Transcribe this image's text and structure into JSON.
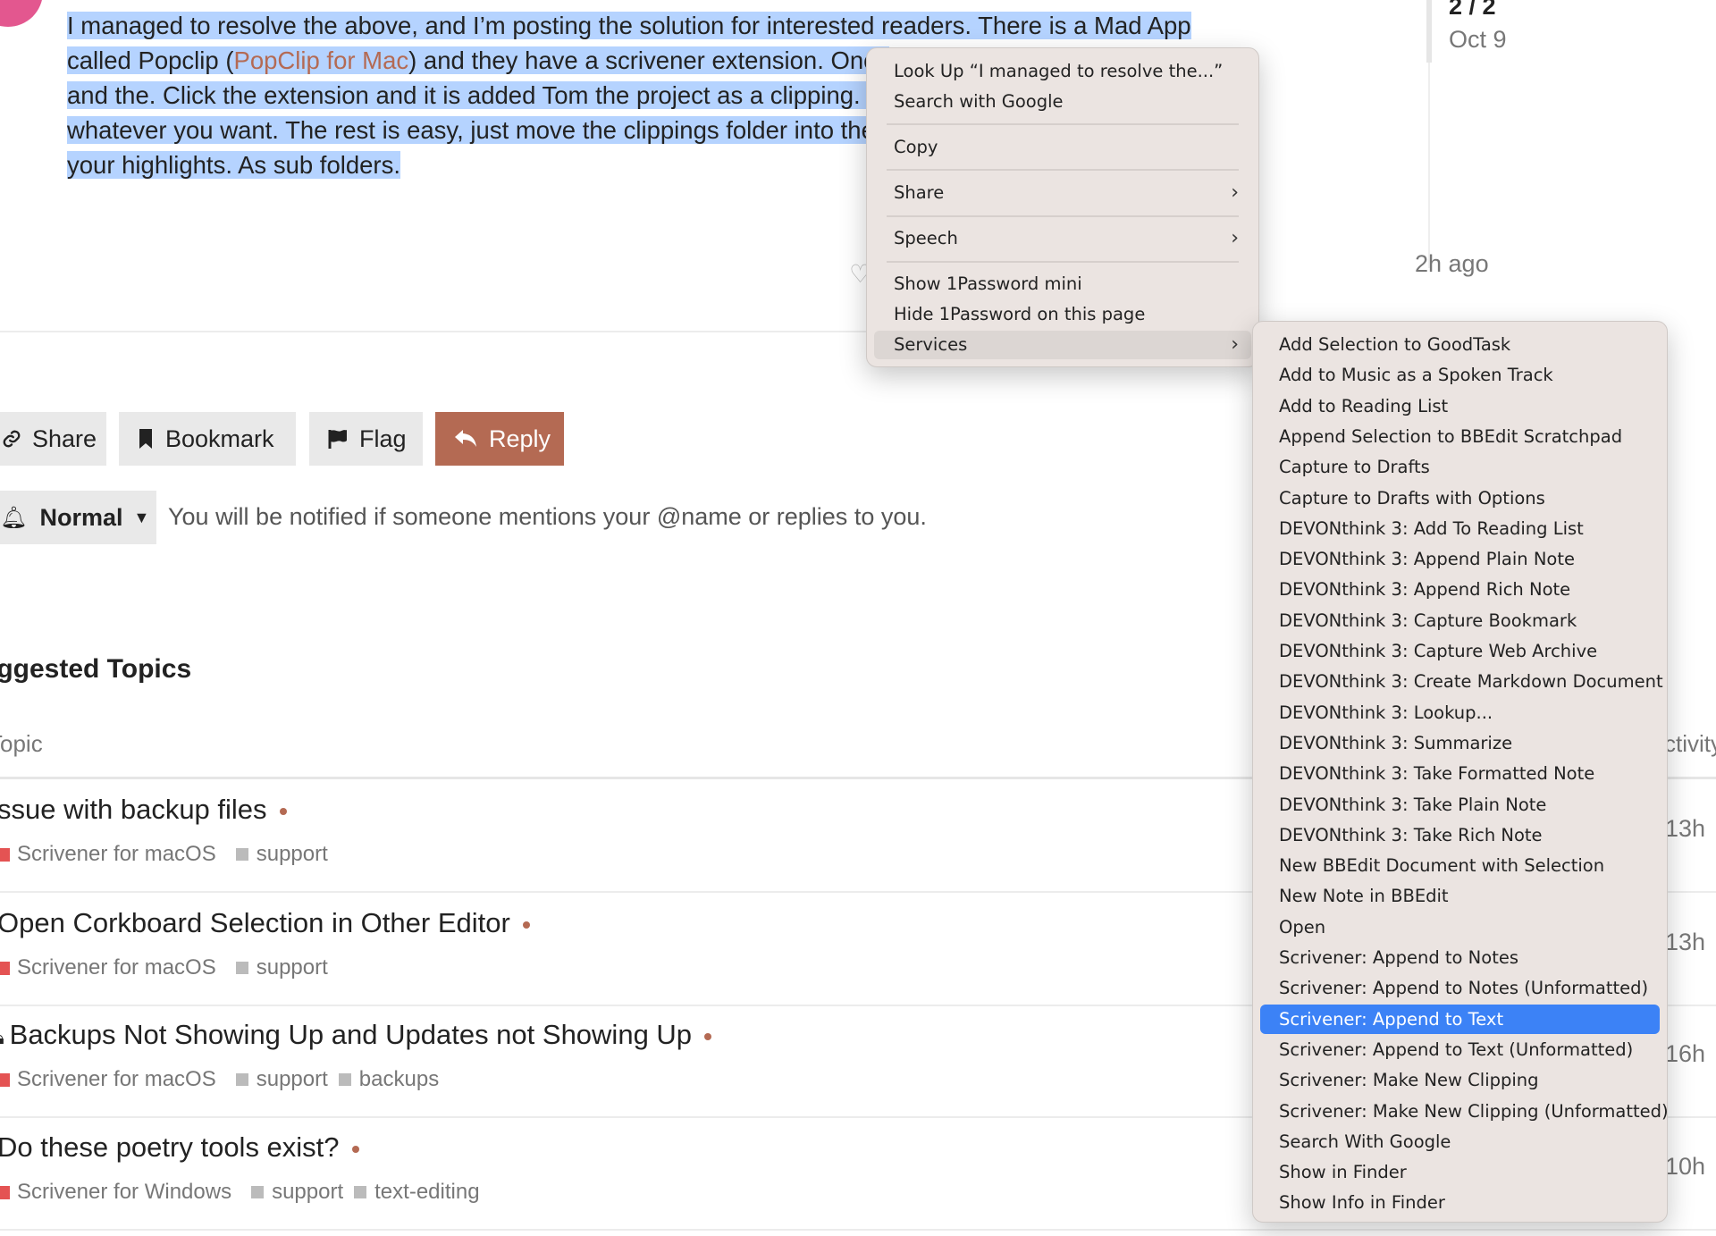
{
  "post": {
    "text_line1": "I managed to resolve the above, and I’m posting the solution for interested readers. There is a Mad App",
    "text_line2_pre": "called Popclip (",
    "text_line2_link": "PopClip for Mac",
    "text_line2_post": ") and they have a scrivener extension. Once",
    "text_line3": "and the. Click the extension and it is added Tom the project as a clipping. Yo",
    "text_line4": "whatever you want. The rest is easy, just move the clippings folder into the p",
    "text_line5": "your highlights. As sub folders."
  },
  "timeline": {
    "count": "2 / 2",
    "date": "Oct 9",
    "ago": "2h ago"
  },
  "actions": {
    "share": "Share",
    "bookmark": "Bookmark",
    "flag": "Flag",
    "reply": "Reply"
  },
  "notification": {
    "level": "Normal",
    "text": "You will be notified if someone mentions your @name or replies to you."
  },
  "suggested": {
    "title": "uggested Topics",
    "col_topic": "Topic",
    "col_activity": "ctivity",
    "topics": [
      {
        "title": "ssue with backup files",
        "category": "Scrivener for macOS",
        "category_color": "#e45353",
        "tags": [
          "support"
        ],
        "activity": "13h"
      },
      {
        "title": "Open Corkboard Selection in Other Editor",
        "category": "Scrivener for macOS",
        "category_color": "#e45353",
        "tags": [
          "support"
        ],
        "activity": "13h"
      },
      {
        "title": "Backups Not Showing Up and Updates not Showing Up",
        "category": "Scrivener for macOS",
        "category_color": "#e45353",
        "tags": [
          "support",
          "backups"
        ],
        "activity": "16h"
      },
      {
        "title": "Do these poetry tools exist?",
        "category": "Scrivener for Windows",
        "category_color": "#e45353",
        "tags": [
          "support",
          "text-editing"
        ],
        "activity": "10h"
      }
    ]
  },
  "context_menu": {
    "look_up": "Look Up “I managed to resolve the...”",
    "search_google": "Search with Google",
    "copy": "Copy",
    "share": "Share",
    "speech": "Speech",
    "show_1password": "Show 1Password mini",
    "hide_1password": "Hide 1Password on this page",
    "services": "Services"
  },
  "services_menu": {
    "items": [
      "Add Selection to GoodTask",
      "Add to Music as a Spoken Track",
      "Add to Reading List",
      "Append Selection to BBEdit Scratchpad",
      "Capture to Drafts",
      "Capture to Drafts with Options",
      "DEVONthink 3: Add To Reading List",
      "DEVONthink 3: Append Plain Note",
      "DEVONthink 3: Append Rich Note",
      "DEVONthink 3: Capture Bookmark",
      "DEVONthink 3: Capture Web Archive",
      "DEVONthink 3: Create Markdown Document",
      "DEVONthink 3: Lookup...",
      "DEVONthink 3: Summarize",
      "DEVONthink 3: Take Formatted Note",
      "DEVONthink 3: Take Plain Note",
      "DEVONthink 3: Take Rich Note",
      "New BBEdit Document with Selection",
      "New Note in BBEdit",
      "Open",
      "Scrivener: Append to Notes",
      "Scrivener: Append to Notes (Unformatted)",
      "Scrivener: Append to Text",
      "Scrivener: Append to Text (Unformatted)",
      "Scrivener: Make New Clipping",
      "Scrivener: Make New Clipping (Unformatted)",
      "Search With Google",
      "Show in Finder",
      "Show Info in Finder"
    ],
    "selected_index": 22
  }
}
